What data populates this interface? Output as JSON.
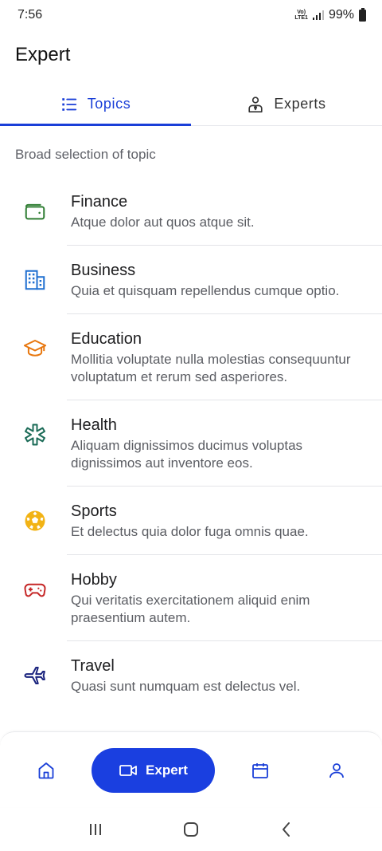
{
  "status": {
    "time": "7:56",
    "network": "Vo) LTE1",
    "battery": "99%"
  },
  "app": {
    "title": "Expert"
  },
  "tabs": [
    {
      "label": "Topics",
      "icon": "list-icon",
      "active": true
    },
    {
      "label": "Experts",
      "icon": "person-tie-icon",
      "active": false
    }
  ],
  "section": {
    "label": "Broad selection of topic"
  },
  "topics": [
    {
      "title": "Finance",
      "description": "Atque dolor aut quos atque sit.",
      "icon": "wallet-icon",
      "color": "#2e7d32"
    },
    {
      "title": "Business",
      "description": "Quia et quisquam repellendus cumque optio.",
      "icon": "building-icon",
      "color": "#1f6fd0"
    },
    {
      "title": "Education",
      "description": "Mollitia voluptate nulla molestias consequuntur voluptatum et rerum sed asperiores.",
      "icon": "graduation-cap-icon",
      "color": "#e8770e"
    },
    {
      "title": "Health",
      "description": "Aliquam dignissimos ducimus voluptas dignissimos aut inventore eos.",
      "icon": "medical-star-icon",
      "color": "#1b6b57"
    },
    {
      "title": "Sports",
      "description": "Et delectus quia dolor fuga omnis quae.",
      "icon": "soccer-ball-icon",
      "color": "#f2b315"
    },
    {
      "title": "Hobby",
      "description": "Qui veritatis exercitationem aliquid enim praesentium autem.",
      "icon": "gamepad-icon",
      "color": "#c62828"
    },
    {
      "title": "Travel",
      "description": "Quasi sunt numquam est delectus vel.",
      "icon": "airplane-icon",
      "color": "#1a237e"
    }
  ],
  "bottom_nav": {
    "home_icon": "home-icon",
    "expert_label": "Expert",
    "expert_icon": "video-icon",
    "calendar_icon": "calendar-icon",
    "profile_icon": "profile-icon",
    "accent": "#1a3fe0"
  }
}
